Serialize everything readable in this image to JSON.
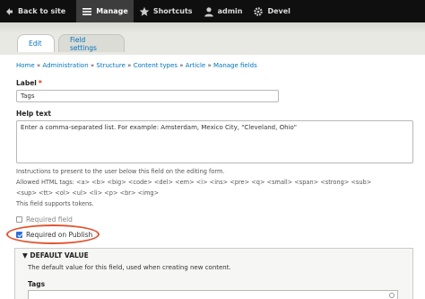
{
  "toolbar": {
    "back": "Back to site",
    "manage": "Manage",
    "shortcuts": "Shortcuts",
    "user": "admin",
    "devel": "Devel"
  },
  "tabs": [
    {
      "label": "Edit"
    },
    {
      "label": "Field settings"
    }
  ],
  "breadcrumb": [
    "Home",
    "Administration",
    "Structure",
    "Content types",
    "Article",
    "Manage fields"
  ],
  "form": {
    "label_title": "Label",
    "label_required_mark": "*",
    "label_value": "Tags",
    "help_title": "Help text",
    "help_value": "Enter a comma-separated list. For example: Amsterdam, Mexico City, \"Cleveland, Ohio\"",
    "help_desc_1": "Instructions to present to the user below this field on the editing form.",
    "help_desc_2": "Allowed HTML tags: <a> <b> <big> <code> <del> <em> <i> <ins> <pre> <q> <small> <span> <strong> <sub>",
    "help_desc_3": "<sup> <tt> <ol> <ul> <li> <p> <br> <img>",
    "help_desc_4": "This field supports tokens.",
    "required_field": "Required field",
    "required_on_publish": "Required on Publish"
  },
  "default_value": {
    "title": "▼ DEFAULT VALUE",
    "description": "The default value for this field, used when creating new content.",
    "tags_label": "Tags"
  },
  "colors": {
    "link": "#0074bd",
    "toolbar": "#0f0f0f",
    "highlight": "#e0532f",
    "checked": "#2a6fdb"
  }
}
